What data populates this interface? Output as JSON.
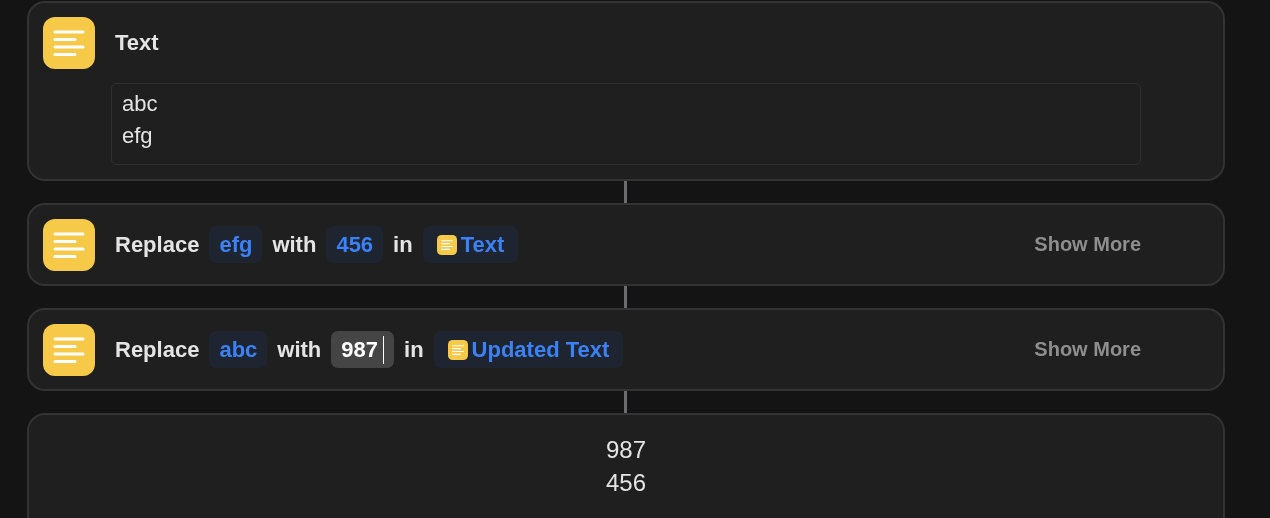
{
  "text_action": {
    "title": "Text",
    "value": "abc\nefg"
  },
  "replace_actions": [
    {
      "verb": "Replace",
      "find": "efg",
      "with_word": "with",
      "replacement": "456",
      "editing": false,
      "in_word": "in",
      "target": "Text",
      "show_more": "Show More"
    },
    {
      "verb": "Replace",
      "find": "abc",
      "with_word": "with",
      "replacement": "987",
      "editing": true,
      "in_word": "in",
      "target": "Updated Text",
      "show_more": "Show More"
    }
  ],
  "result": {
    "value": "987\n456"
  }
}
